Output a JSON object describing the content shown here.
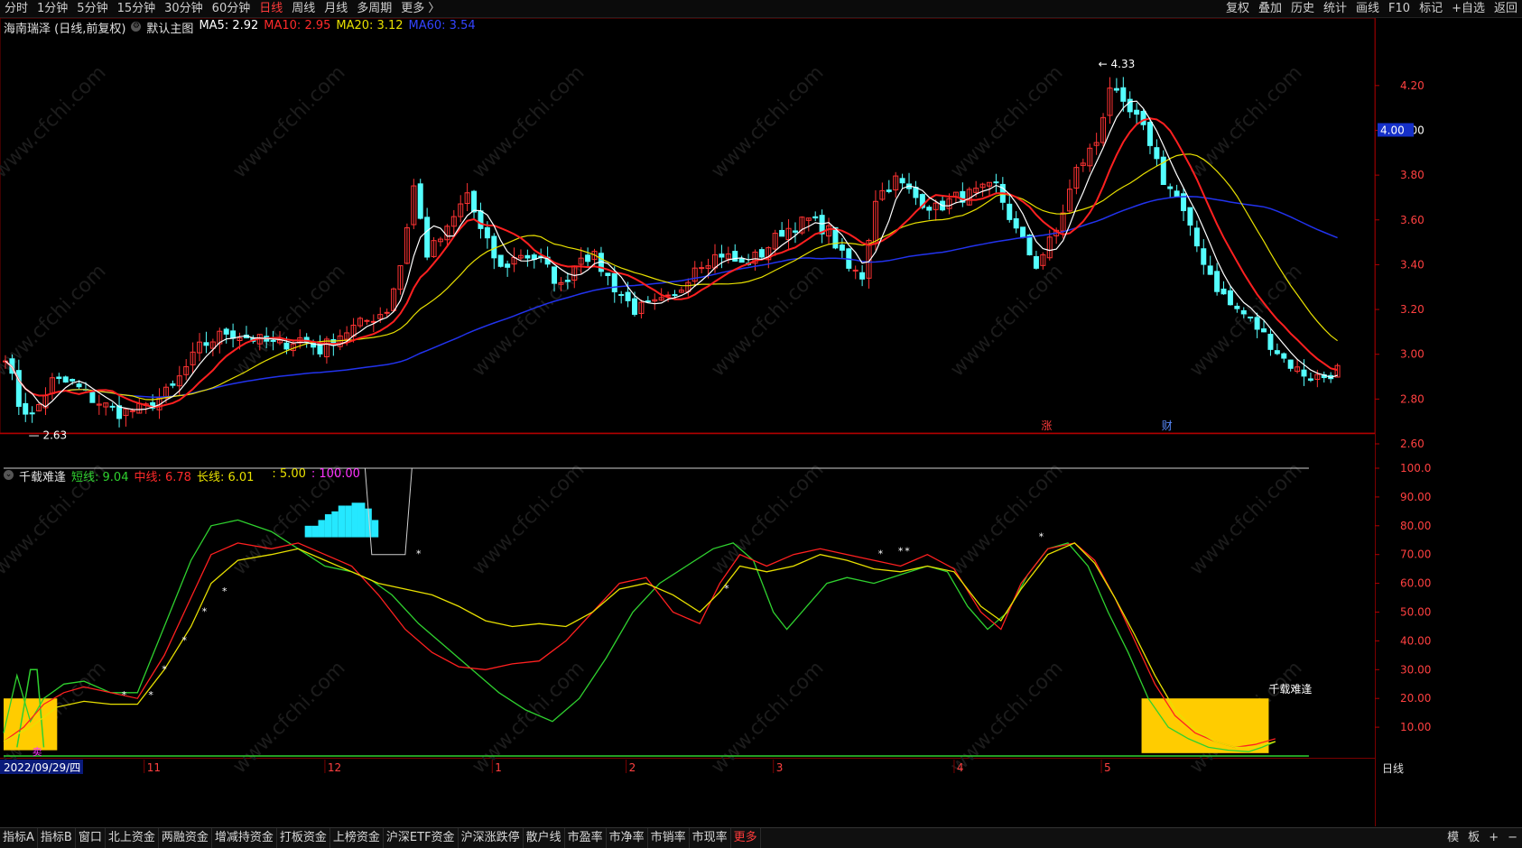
{
  "top_toolbar": {
    "periods": [
      "分时",
      "1分钟",
      "5分钟",
      "15分钟",
      "30分钟",
      "60分钟",
      "日线",
      "周线",
      "月线",
      "多周期",
      "更多 〉"
    ],
    "active": "日线",
    "right": [
      "复权",
      "叠加",
      "历史",
      "统计",
      "画线",
      "F10",
      "标记",
      "+自选",
      "返回"
    ]
  },
  "main_info": {
    "stock": "海南瑞泽 (日线,前复权)",
    "template": "默认主图",
    "ma5": "MA5: 2.92",
    "ma10": "MA10: 2.95",
    "ma20": "MA20: 3.12",
    "ma60": "MA60: 3.54"
  },
  "sub_info": {
    "name": "千载难逢",
    "short": "短线: 9.04",
    "mid": "中线: 6.78",
    "long": "长线: 6.01",
    "v1": ": 5.00",
    "v2": ": 100.00"
  },
  "bottom_toolbar": {
    "items": [
      "指标A",
      "指标B",
      "窗口",
      "北上资金",
      "两融资金",
      "增减持资金",
      "打板资金",
      "上榜资金",
      "沪深ETF资金",
      "沪深涨跌停",
      "散户线",
      "市盈率",
      "市净率",
      "市销率",
      "市现率",
      "更多"
    ],
    "right": [
      "模",
      "板",
      "+",
      "−"
    ]
  },
  "colors": {
    "up": "#ff3333",
    "down": "#54ffff",
    "ma5": "#ffffff",
    "ma10": "#ff2020",
    "ma20": "#e8e000",
    "ma60": "#2233ee",
    "short_line": "#2fd12f",
    "mid_line": "#ff2020",
    "long_line": "#e8e000",
    "fill_yellow": "#ffcc00"
  },
  "chart_data": [
    {
      "type": "candlestick",
      "title": "海南瑞泽 (日线,前复权)",
      "ylim": [
        2.6,
        4.35
      ],
      "yticks": [
        "4.20",
        "4.00",
        "3.80",
        "3.60",
        "3.40",
        "3.20",
        "3.00",
        "2.80",
        "2.60"
      ],
      "current_price_label": "4.00",
      "max_label": "4.33",
      "min_label": "2.63",
      "markers": [
        "涨",
        "财"
      ],
      "period_label": "日线",
      "date_label": "2022/09/29/四",
      "month_labels": [
        "11",
        "12",
        "1",
        "2",
        "3",
        "4",
        "5"
      ],
      "waypoints": [
        [
          0,
          3.0
        ],
        [
          2,
          2.78
        ],
        [
          4,
          2.72
        ],
        [
          7,
          2.88
        ],
        [
          10,
          2.87
        ],
        [
          13,
          2.8
        ],
        [
          17,
          2.74
        ],
        [
          21,
          2.76
        ],
        [
          25,
          2.85
        ],
        [
          29,
          3.03
        ],
        [
          33,
          3.1
        ],
        [
          37,
          3.07
        ],
        [
          41,
          3.04
        ],
        [
          44,
          3.07
        ],
        [
          47,
          3.02
        ],
        [
          50,
          3.09
        ],
        [
          54,
          3.15
        ],
        [
          57,
          3.2
        ],
        [
          59,
          3.4
        ],
        [
          61,
          3.75
        ],
        [
          63,
          3.45
        ],
        [
          66,
          3.55
        ],
        [
          69,
          3.72
        ],
        [
          71,
          3.55
        ],
        [
          74,
          3.38
        ],
        [
          77,
          3.45
        ],
        [
          80,
          3.42
        ],
        [
          83,
          3.3
        ],
        [
          86,
          3.45
        ],
        [
          88,
          3.43
        ],
        [
          91,
          3.3
        ],
        [
          94,
          3.2
        ],
        [
          97,
          3.22
        ],
        [
          100,
          3.25
        ],
        [
          103,
          3.4
        ],
        [
          107,
          3.45
        ],
        [
          110,
          3.4
        ],
        [
          113,
          3.45
        ],
        [
          116,
          3.55
        ],
        [
          120,
          3.6
        ],
        [
          123,
          3.55
        ],
        [
          126,
          3.38
        ],
        [
          128,
          3.35
        ],
        [
          130,
          3.7
        ],
        [
          133,
          3.78
        ],
        [
          136,
          3.7
        ],
        [
          139,
          3.65
        ],
        [
          142,
          3.7
        ],
        [
          145,
          3.72
        ],
        [
          148,
          3.75
        ],
        [
          151,
          3.55
        ],
        [
          154,
          3.4
        ],
        [
          157,
          3.55
        ],
        [
          160,
          3.82
        ],
        [
          163,
          3.95
        ],
        [
          165,
          4.2
        ],
        [
          167,
          4.1
        ],
        [
          169,
          4.05
        ],
        [
          171,
          3.95
        ],
        [
          173,
          3.78
        ],
        [
          175,
          3.7
        ],
        [
          177,
          3.55
        ],
        [
          179,
          3.42
        ],
        [
          181,
          3.3
        ],
        [
          183,
          3.22
        ],
        [
          185,
          3.18
        ],
        [
          187,
          3.12
        ],
        [
          189,
          3.05
        ],
        [
          191,
          2.98
        ],
        [
          193,
          2.93
        ],
        [
          195,
          2.9
        ],
        [
          197,
          2.9
        ],
        [
          200,
          2.95
        ]
      ]
    },
    {
      "type": "line",
      "title": "千载难逢",
      "ylim": [
        0,
        105
      ],
      "yticks": [
        "100.0",
        "90.00",
        "80.00",
        "70.00",
        "60.00",
        "50.00",
        "40.00",
        "30.00",
        "20.00",
        "10.00"
      ],
      "series": [
        {
          "name": "短线",
          "values": [
            [
              0,
              8
            ],
            [
              2,
              28
            ],
            [
              4,
              12
            ],
            [
              6,
              20
            ],
            [
              9,
              25
            ],
            [
              12,
              26
            ],
            [
              16,
              22
            ],
            [
              20,
              22
            ],
            [
              24,
              45
            ],
            [
              28,
              68
            ],
            [
              31,
              80
            ],
            [
              35,
              82
            ],
            [
              40,
              78
            ],
            [
              44,
              72
            ],
            [
              48,
              66
            ],
            [
              52,
              64
            ],
            [
              55,
              61
            ],
            [
              58,
              56
            ],
            [
              62,
              46
            ],
            [
              66,
              38
            ],
            [
              70,
              30
            ],
            [
              74,
              22
            ],
            [
              78,
              16
            ],
            [
              82,
              12
            ],
            [
              86,
              20
            ],
            [
              90,
              34
            ],
            [
              94,
              50
            ],
            [
              98,
              60
            ],
            [
              102,
              66
            ],
            [
              106,
              72
            ],
            [
              109,
              74
            ],
            [
              112,
              68
            ],
            [
              115,
              50
            ],
            [
              117,
              44
            ],
            [
              120,
              52
            ],
            [
              123,
              60
            ],
            [
              126,
              62
            ],
            [
              130,
              60
            ],
            [
              134,
              63
            ],
            [
              138,
              66
            ],
            [
              141,
              64
            ],
            [
              144,
              52
            ],
            [
              147,
              44
            ],
            [
              150,
              50
            ],
            [
              153,
              63
            ],
            [
              156,
              72
            ],
            [
              159,
              74
            ],
            [
              162,
              66
            ],
            [
              165,
              50
            ],
            [
              168,
              36
            ],
            [
              171,
              20
            ],
            [
              174,
              10
            ],
            [
              177,
              6
            ],
            [
              180,
              3
            ],
            [
              183,
              2
            ],
            [
              186,
              1.5
            ],
            [
              188,
              3
            ],
            [
              190,
              5
            ]
          ]
        },
        {
          "name": "中线",
          "values": [
            [
              0,
              5
            ],
            [
              3,
              10
            ],
            [
              6,
              18
            ],
            [
              9,
              22
            ],
            [
              12,
              24
            ],
            [
              16,
              22
            ],
            [
              20,
              20
            ],
            [
              24,
              35
            ],
            [
              28,
              55
            ],
            [
              31,
              70
            ],
            [
              35,
              74
            ],
            [
              40,
              72
            ],
            [
              44,
              74
            ],
            [
              48,
              70
            ],
            [
              52,
              66
            ],
            [
              56,
              56
            ],
            [
              60,
              44
            ],
            [
              64,
              36
            ],
            [
              68,
              31
            ],
            [
              72,
              30
            ],
            [
              76,
              32
            ],
            [
              80,
              33
            ],
            [
              84,
              40
            ],
            [
              88,
              50
            ],
            [
              92,
              60
            ],
            [
              96,
              62
            ],
            [
              100,
              50
            ],
            [
              104,
              46
            ],
            [
              107,
              60
            ],
            [
              110,
              70
            ],
            [
              114,
              66
            ],
            [
              118,
              70
            ],
            [
              122,
              72
            ],
            [
              126,
              70
            ],
            [
              130,
              68
            ],
            [
              134,
              66
            ],
            [
              138,
              70
            ],
            [
              142,
              65
            ],
            [
              146,
              50
            ],
            [
              149,
              44
            ],
            [
              152,
              60
            ],
            [
              156,
              72
            ],
            [
              160,
              74
            ],
            [
              163,
              68
            ],
            [
              166,
              55
            ],
            [
              169,
              40
            ],
            [
              172,
              25
            ],
            [
              175,
              14
            ],
            [
              178,
              8
            ],
            [
              181,
              5
            ],
            [
              184,
              3
            ],
            [
              187,
              4
            ],
            [
              190,
              6
            ]
          ]
        },
        {
          "name": "长线",
          "values": [
            [
              0,
              5
            ],
            [
              4,
              10
            ],
            [
              8,
              17
            ],
            [
              12,
              19
            ],
            [
              16,
              18
            ],
            [
              20,
              18
            ],
            [
              24,
              30
            ],
            [
              28,
              45
            ],
            [
              31,
              60
            ],
            [
              35,
              68
            ],
            [
              40,
              70
            ],
            [
              44,
              72
            ],
            [
              48,
              68
            ],
            [
              52,
              64
            ],
            [
              56,
              60
            ],
            [
              60,
              58
            ],
            [
              64,
              56
            ],
            [
              68,
              52
            ],
            [
              72,
              47
            ],
            [
              76,
              45
            ],
            [
              80,
              46
            ],
            [
              84,
              45
            ],
            [
              88,
              50
            ],
            [
              92,
              58
            ],
            [
              96,
              60
            ],
            [
              100,
              56
            ],
            [
              104,
              50
            ],
            [
              107,
              57
            ],
            [
              110,
              66
            ],
            [
              114,
              64
            ],
            [
              118,
              66
            ],
            [
              122,
              70
            ],
            [
              126,
              68
            ],
            [
              130,
              65
            ],
            [
              134,
              64
            ],
            [
              138,
              66
            ],
            [
              142,
              64
            ],
            [
              146,
              52
            ],
            [
              149,
              47
            ],
            [
              152,
              58
            ],
            [
              156,
              70
            ],
            [
              160,
              74
            ],
            [
              163,
              67
            ],
            [
              166,
              55
            ],
            [
              169,
              42
            ],
            [
              172,
              28
            ],
            [
              175,
              16
            ],
            [
              178,
              9
            ],
            [
              181,
              5
            ],
            [
              184,
              3
            ],
            [
              187,
              3
            ],
            [
              190,
              5
            ]
          ]
        }
      ],
      "annotations": [
        "卖",
        "千载难逢"
      ]
    }
  ]
}
